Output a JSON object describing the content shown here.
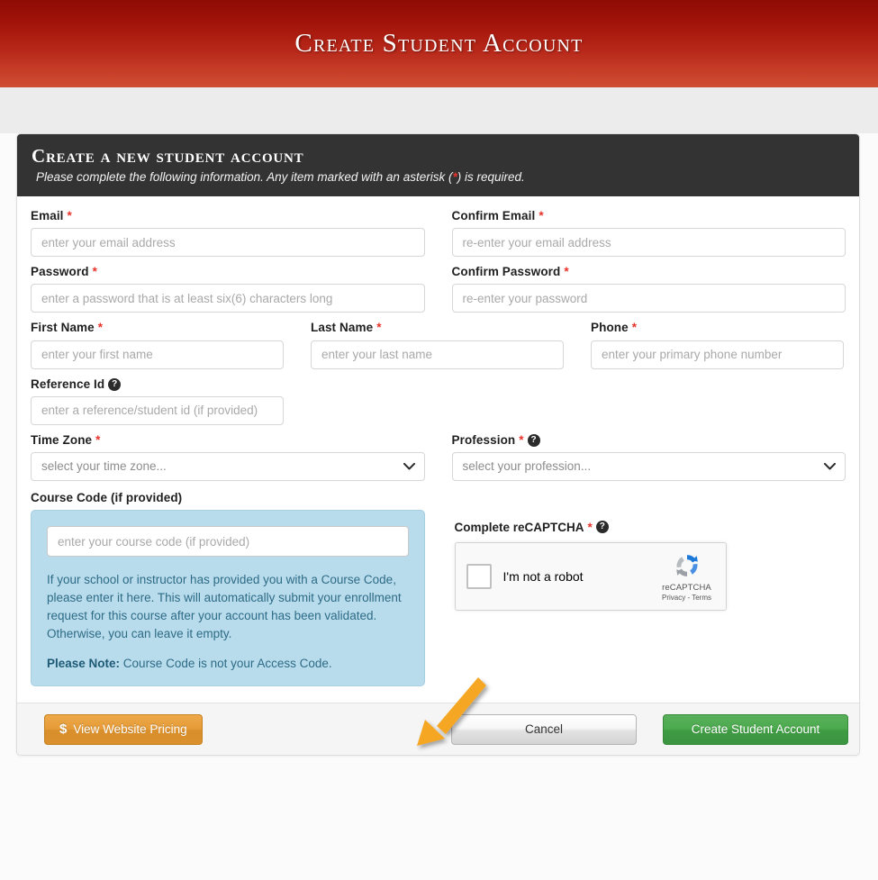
{
  "banner": {
    "title": "Create Student Account"
  },
  "panel": {
    "heading": "Create a new student account",
    "subheading_pre": "Please complete the following information. Any item marked with an asterisk (",
    "subheading_star": "*",
    "subheading_post": ") is required."
  },
  "fields": {
    "email": {
      "label": "Email",
      "required": "*",
      "placeholder": "enter your email address",
      "value": ""
    },
    "confirm_email": {
      "label": "Confirm Email",
      "required": "*",
      "placeholder": "re-enter your email address",
      "value": ""
    },
    "password": {
      "label": "Password",
      "required": "*",
      "placeholder": "enter a password that is at least six(6) characters long",
      "value": ""
    },
    "confirm_password": {
      "label": "Confirm Password",
      "required": "*",
      "placeholder": "re-enter your password",
      "value": ""
    },
    "first_name": {
      "label": "First Name",
      "required": "*",
      "placeholder": "enter your first name",
      "value": ""
    },
    "last_name": {
      "label": "Last Name",
      "required": "*",
      "placeholder": "enter your last name",
      "value": ""
    },
    "phone": {
      "label": "Phone",
      "required": "*",
      "placeholder": "enter your primary phone number",
      "value": ""
    },
    "reference_id": {
      "label": "Reference Id",
      "help": "?",
      "placeholder": "enter a reference/student id (if provided)",
      "value": ""
    },
    "time_zone": {
      "label": "Time Zone",
      "required": "*",
      "selected": "select your time zone...",
      "icon": "chevron-down-icon"
    },
    "profession": {
      "label": "Profession",
      "required": "*",
      "help": "?",
      "selected": "select your profession...",
      "icon": "chevron-down-icon"
    },
    "course_code": {
      "label": "Course Code (if provided)",
      "placeholder": "enter your course code (if provided)",
      "value": "",
      "note": "If your school or instructor has provided you with a Course Code, please enter it here. This will automatically submit your enrollment request for this course after your account has been validated. Otherwise, you can leave it empty.",
      "note_bold": "Please Note:",
      "note_rest": " Course Code is not your Access Code."
    }
  },
  "captcha": {
    "label": "Complete reCAPTCHA",
    "required": "*",
    "help": "?",
    "checkbox_label": "I'm not a robot",
    "brand": "reCAPTCHA",
    "legal": "Privacy - Terms"
  },
  "footer": {
    "pricing_icon": "$",
    "pricing_label": "View Website Pricing",
    "cancel_label": "Cancel",
    "create_label": "Create Student Account"
  },
  "annotation": {
    "type": "arrow",
    "color": "#F5A623",
    "points_to": "course-code-input"
  },
  "colors": {
    "banner_top": "#8e0c05",
    "banner_bottom": "#cf4e33",
    "panel_head": "#333333",
    "required_star": "#e8332a",
    "highlight_box": "#b9dcec",
    "highlight_text": "#2d6b86",
    "primary_button": "#4caa4e",
    "pricing_button": "#e49a35",
    "arrow": "#F5A623"
  }
}
